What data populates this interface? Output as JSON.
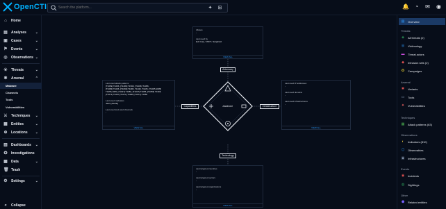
{
  "app": {
    "name": "OpenCTI"
  },
  "search": {
    "placeholder": "Search the platform..."
  },
  "sidebar": {
    "items": [
      {
        "label": "Home",
        "icon": "home-icon",
        "chevron": false
      },
      {
        "label": "Analyses",
        "icon": "analyses-icon",
        "chevron": true
      },
      {
        "label": "Cases",
        "icon": "cases-icon",
        "chevron": true
      },
      {
        "label": "Events",
        "icon": "events-icon",
        "chevron": true
      },
      {
        "label": "Observations",
        "icon": "observations-icon",
        "chevron": true
      },
      {
        "label": "Threats",
        "icon": "threats-icon",
        "chevron": true
      },
      {
        "label": "Arsenal",
        "icon": "arsenal-icon",
        "chevron": true
      }
    ],
    "arsenal_sub": [
      "Malware",
      "Channels",
      "Tools",
      "Vulnerabilities"
    ],
    "items2": [
      {
        "label": "Techniques",
        "icon": "techniques-icon",
        "chevron": true
      },
      {
        "label": "Entities",
        "icon": "entities-icon",
        "chevron": true
      },
      {
        "label": "Locations",
        "icon": "locations-icon",
        "chevron": true
      },
      {
        "label": "Dashboards",
        "icon": "dashboards-icon",
        "chevron": true
      },
      {
        "label": "Investigations",
        "icon": "investigations-icon",
        "chevron": false
      },
      {
        "label": "Data",
        "icon": "data-icon",
        "chevron": true
      },
      {
        "label": "Trash",
        "icon": "trash-icon",
        "chevron": false
      },
      {
        "label": "Settings",
        "icon": "settings-icon",
        "chevron": true
      }
    ],
    "collapse": "Collapse"
  },
  "diagram": {
    "top_card": {
      "l1": "Aliases",
      "v1": "-",
      "l2": "Last used by",
      "v2": "Evil Corp, TA577, Sangfroid",
      "view_all": "VIEW ALL"
    },
    "left_card": {
      "l1": "Last used attack patterns",
      "v1a": "[T1059] T1056, [T1486] T1569, [T1036] T1056,",
      "v1b": "[T1083] T1036, [T1069] T1082, T1049, T1105, [T1005,1005]",
      "v1c": "T1055,1005, [T1027] T1082, [T1027] T1055, [T1055] T1395,",
      "v1d": "[T1071] T1057 [T1071] T1085 [T1071] T1059",
      "l2": "Last used malwares",
      "v2": "Jaws [Jawhb]",
      "l3": "Last used tools and channels",
      "v3": "-",
      "view_all": "VIEW ALL"
    },
    "right_card": {
      "l1": "Last used IP addresses",
      "v1": "-",
      "l2": "Last used domains",
      "v2": "-",
      "l3": "Last used infrastructures",
      "v3": "-",
      "view_all": "VIEW ALL"
    },
    "bottom_card": {
      "l1": "Last targeted countries",
      "v1": "-",
      "l2": "Last targeted sectors",
      "v2": "-",
      "l3": "Last targeted organizations",
      "v3": "-",
      "view_all": "VIEW ALL"
    },
    "nodes": {
      "top": "Adversary",
      "left": "Capabilities",
      "right": "Infrastructure",
      "bottom": "Technology",
      "center": "Jawdrone"
    }
  },
  "right_panel": {
    "overview": "Overview",
    "sections": [
      {
        "title": "Threats",
        "items": [
          {
            "label": "All threats (2)",
            "icon": "threat-icon",
            "color": "#2e9e5b"
          },
          {
            "label": "Victimology",
            "icon": "victimology-icon",
            "color": "#2f9cff"
          },
          {
            "label": "Threat actors",
            "icon": "threat-actor-icon",
            "color": "#c74bd9"
          },
          {
            "label": "Intrusion sets (2)",
            "icon": "intrusion-set-icon",
            "color": "#e05252"
          },
          {
            "label": "Campaigns",
            "icon": "campaign-icon",
            "color": "#d8c32d"
          }
        ]
      },
      {
        "title": "Arsenal",
        "items": [
          {
            "label": "Variants",
            "icon": "variant-icon",
            "color": "#e05252"
          },
          {
            "label": "Tools",
            "icon": "tool-icon",
            "color": "#8fa3bf"
          },
          {
            "label": "Vulnerabilities",
            "icon": "vulnerability-icon",
            "color": "#d85a5a"
          }
        ]
      },
      {
        "title": "Techniques",
        "items": [
          {
            "label": "Attack patterns (63)",
            "icon": "attack-pattern-icon",
            "color": "#4caf50"
          }
        ]
      },
      {
        "title": "Observations",
        "items": [
          {
            "label": "Indicators (810)",
            "icon": "indicator-icon",
            "color": "#e0c23a"
          },
          {
            "label": "Observables",
            "icon": "observable-icon",
            "color": "#2f9cff"
          },
          {
            "label": "Infrastructures",
            "icon": "infrastructure-icon",
            "color": "#7c8ba3"
          }
        ]
      },
      {
        "title": "Events",
        "items": [
          {
            "label": "Incidents",
            "icon": "incident-icon",
            "color": "#e05252"
          },
          {
            "label": "Sightings",
            "icon": "sighting-icon",
            "color": "#2e9e5b"
          }
        ]
      },
      {
        "title": "Other",
        "items": [
          {
            "label": "Related entities",
            "icon": "related-icon",
            "color": "#7b61ff"
          }
        ]
      }
    ]
  }
}
